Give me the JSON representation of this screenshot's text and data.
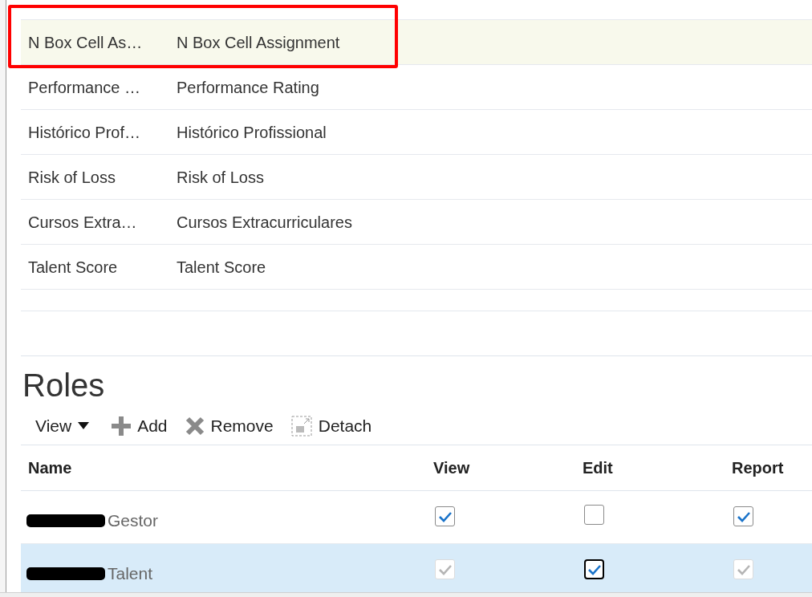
{
  "attributes": {
    "rows": [
      {
        "short": "N Box Cell As…",
        "full": "N Box Cell Assignment",
        "selected": true,
        "annotated": true
      },
      {
        "short": "Performance …",
        "full": "Performance Rating",
        "selected": false,
        "annotated": false
      },
      {
        "short": "Histórico Prof…",
        "full": "Histórico Profissional",
        "selected": false,
        "annotated": false
      },
      {
        "short": "Risk of Loss",
        "full": "Risk of Loss",
        "selected": false,
        "annotated": false
      },
      {
        "short": "Cursos Extra…",
        "full": "Cursos Extracurriculares",
        "selected": false,
        "annotated": false
      },
      {
        "short": "Talent Score",
        "full": "Talent Score",
        "selected": false,
        "annotated": false
      }
    ]
  },
  "roles": {
    "title": "Roles",
    "toolbar": [
      {
        "kind": "menu",
        "label": "View"
      },
      {
        "kind": "add",
        "label": "Add"
      },
      {
        "kind": "remove",
        "label": "Remove"
      },
      {
        "kind": "detach",
        "label": "Detach"
      }
    ],
    "columns": [
      "Name",
      "View",
      "Edit",
      "Report"
    ],
    "rows": [
      {
        "name": "Gestor",
        "redacted": true,
        "selected": false,
        "permissions": [
          {
            "checked": true,
            "disabled": false,
            "focused": false
          },
          {
            "checked": false,
            "disabled": false,
            "focused": false
          },
          {
            "checked": true,
            "disabled": false,
            "focused": false
          }
        ]
      },
      {
        "name": "Talent",
        "redacted": true,
        "selected": true,
        "permissions": [
          {
            "checked": true,
            "disabled": true,
            "focused": false
          },
          {
            "checked": true,
            "disabled": false,
            "focused": true
          },
          {
            "checked": true,
            "disabled": true,
            "focused": false
          }
        ]
      }
    ]
  }
}
